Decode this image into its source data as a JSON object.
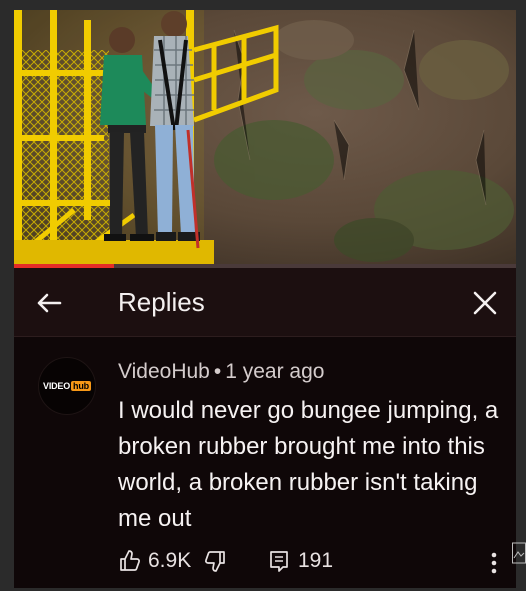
{
  "video": {
    "progress_fraction": 0.2,
    "colors": {
      "progress": "#e52d27",
      "track": "#4a3a3a"
    }
  },
  "replies_panel": {
    "title": "Replies",
    "back_icon": "arrow-left-icon",
    "close_icon": "close-icon"
  },
  "comment": {
    "avatar_logo_left": "VIDEO",
    "avatar_logo_right": "hub",
    "author": "VideoHub",
    "separator": "•",
    "time": "1 year ago",
    "text": "I would never go bungee jumping, a broken rubber brought me into this world, a broken rubber isn't taking me out",
    "likes": "6.9K",
    "replies": "191",
    "icons": {
      "like": "thumbs-up-icon",
      "dislike": "thumbs-down-icon",
      "replies": "reply-icon",
      "more": "more-vertical-icon"
    }
  },
  "colors": {
    "header_bg": "#1c0f10",
    "comment_bg": "#0f0708",
    "logo_accent": "#f79817"
  }
}
